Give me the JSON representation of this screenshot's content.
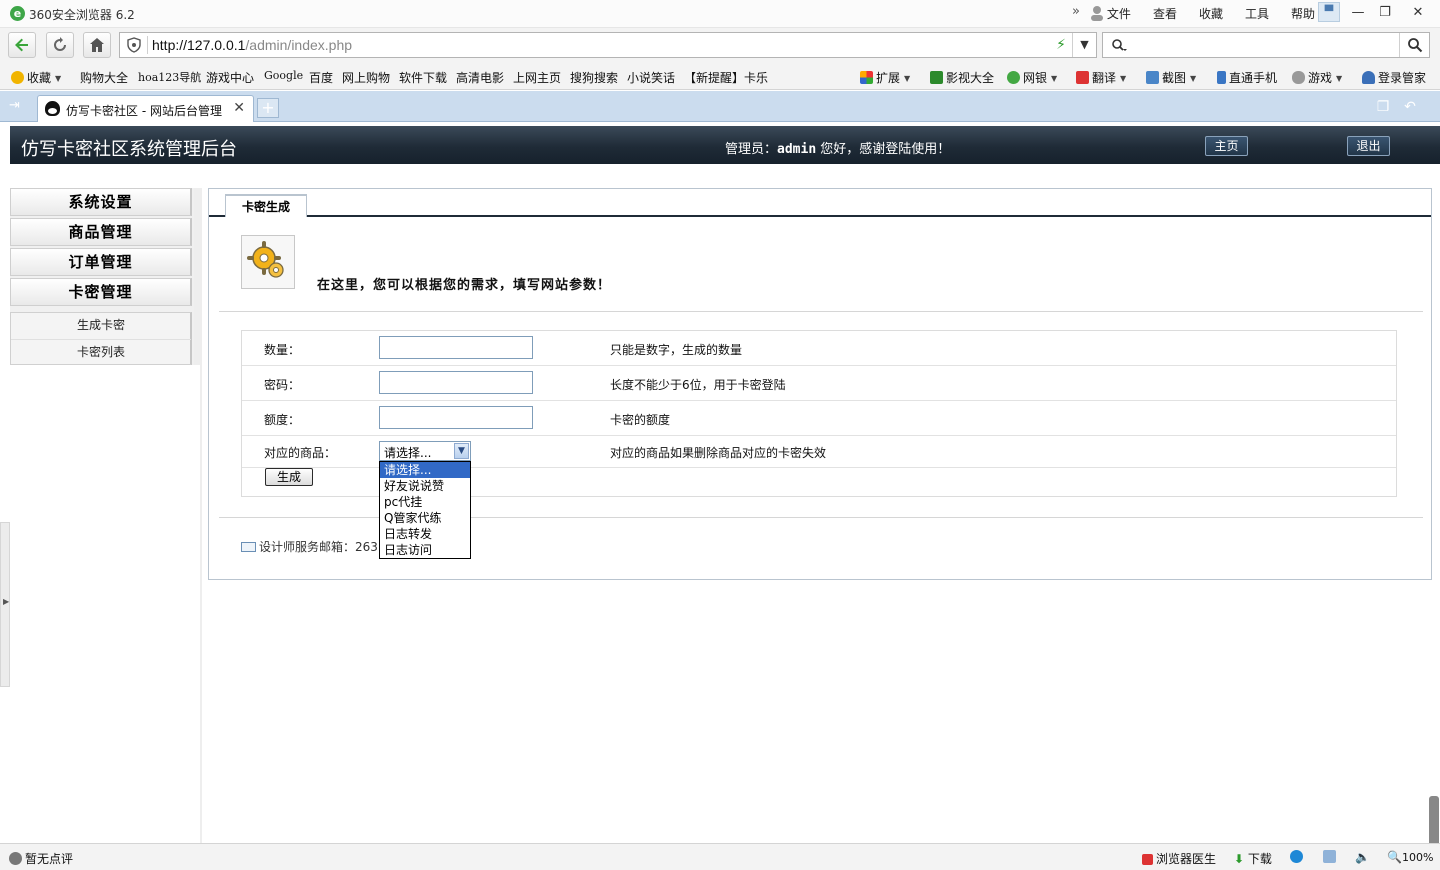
{
  "browser": {
    "app_title": "360安全浏览器 6.2",
    "menu": [
      "文件",
      "查看",
      "收藏",
      "工具",
      "帮助"
    ],
    "url_host": "http://127.0.0.1",
    "url_path": "/admin/index.php",
    "search_value": "",
    "bookmarks_left": [
      "收藏",
      "购物大全",
      "hoa123导航",
      "游戏中心",
      "Google",
      "百度",
      "网上购物",
      "软件下载",
      "高清电影",
      "上网主页",
      "搜狗搜索",
      "小说笑话",
      "【新提醒】卡乐"
    ],
    "bookmarks_right": [
      "扩展",
      "影视大全",
      "网银",
      "翻译",
      "截图",
      "直通手机",
      "游戏",
      "登录管家"
    ],
    "tab_title": "仿写卡密社区 - 网站后台管理",
    "status_left": "暂无点评",
    "status_right": [
      "浏览器医生",
      "下载",
      "100%"
    ]
  },
  "header": {
    "title": "仿写卡密社区系统管理后台",
    "welcome_prefix": "管理员：",
    "username": "admin",
    "welcome_suffix": " 您好，感谢登陆使用！",
    "home_button": "主页",
    "logout_button": "退出"
  },
  "sidebar": {
    "sections": [
      "系统设置",
      "商品管理",
      "订单管理",
      "卡密管理"
    ],
    "subitems": [
      "生成卡密",
      "卡密列表"
    ]
  },
  "panel": {
    "tab": "卡密生成",
    "intro": "在这里，您可以根据您的需求，填写网站参数！",
    "rows": [
      {
        "label": "数量：",
        "value": "",
        "hint": "只能是数字，生成的数量"
      },
      {
        "label": "密码：",
        "value": "",
        "hint": "长度不能少于6位，用于卡密登陆"
      },
      {
        "label": "额度：",
        "value": "",
        "hint": "卡密的额度"
      },
      {
        "label": "对应的商品：",
        "value": "请选择...",
        "hint": "对应的商品如果删除商品对应的卡密失效"
      }
    ],
    "submit_button": "生成",
    "footer_email_label": "设计师服务邮箱：263"
  },
  "dropdown": {
    "options": [
      "请选择...",
      "好友说说赞",
      "pc代挂",
      "Q管家代练",
      "日志转发",
      "日志访问"
    ],
    "selected_index": 0
  }
}
